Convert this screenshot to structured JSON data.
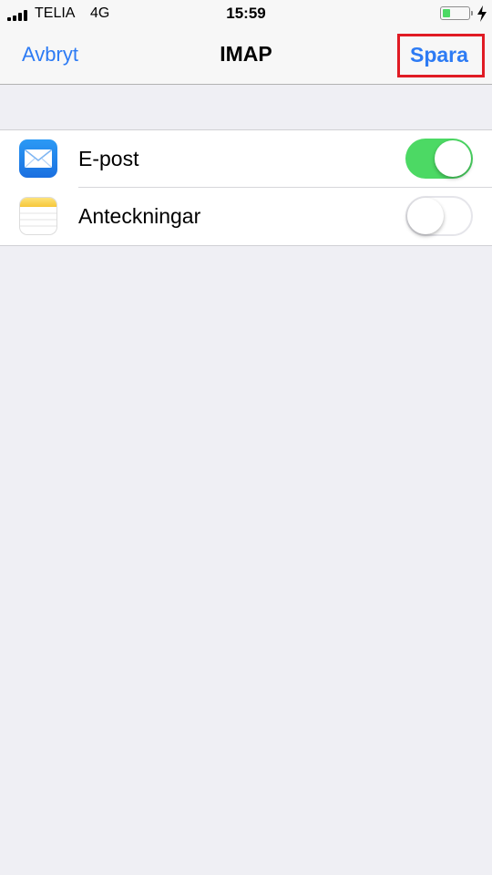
{
  "status_bar": {
    "carrier": "TELIA",
    "network": "4G",
    "time": "15:59",
    "battery_level": 0.3,
    "charging": true
  },
  "nav_bar": {
    "cancel_label": "Avbryt",
    "title": "IMAP",
    "save_label": "Spara",
    "highlight_color": "#e01b24"
  },
  "settings": {
    "items": [
      {
        "label": "E-post",
        "icon": "mail-icon",
        "enabled": true
      },
      {
        "label": "Anteckningar",
        "icon": "notes-icon",
        "enabled": false
      }
    ]
  },
  "colors": {
    "accent": "#2d7bf4",
    "toggle_on": "#4cd964",
    "background": "#efeff4"
  }
}
